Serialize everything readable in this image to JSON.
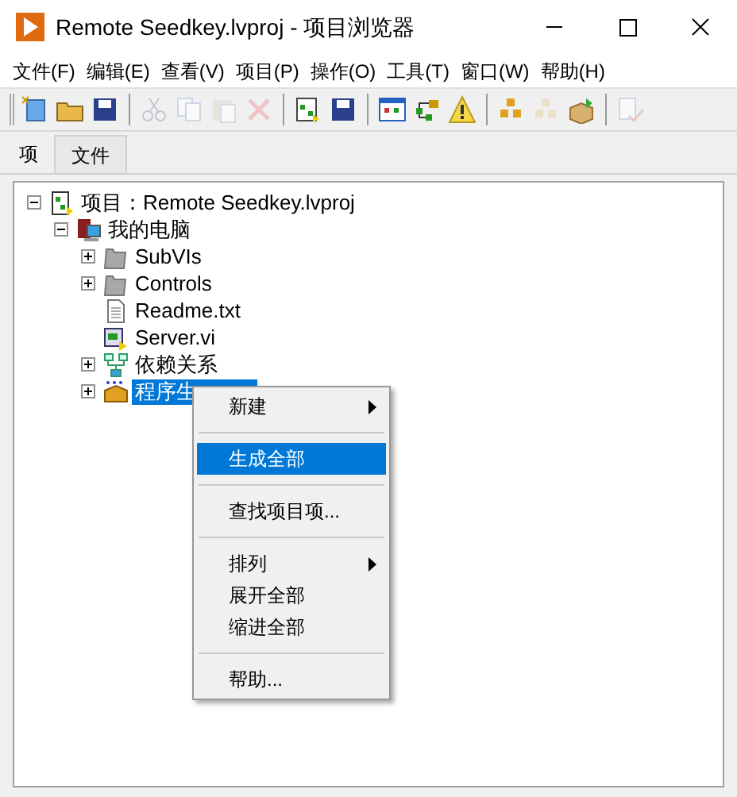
{
  "window": {
    "title": "Remote Seedkey.lvproj - 项目浏览器"
  },
  "menu_bar": [
    "文件(F)",
    "编辑(E)",
    "查看(V)",
    "项目(P)",
    "操作(O)",
    "工具(T)",
    "窗口(W)",
    "帮助(H)"
  ],
  "toolbar": [
    {
      "kind": "new",
      "disabled": false
    },
    {
      "kind": "open",
      "disabled": false
    },
    {
      "kind": "save",
      "disabled": false
    },
    {
      "kind": "sep"
    },
    {
      "kind": "cut",
      "disabled": true
    },
    {
      "kind": "copy",
      "disabled": true
    },
    {
      "kind": "paste",
      "disabled": true
    },
    {
      "kind": "delete",
      "disabled": true
    },
    {
      "kind": "sep"
    },
    {
      "kind": "vi",
      "disabled": false
    },
    {
      "kind": "save",
      "disabled": false
    },
    {
      "kind": "sep"
    },
    {
      "kind": "view",
      "disabled": false
    },
    {
      "kind": "tree",
      "disabled": false
    },
    {
      "kind": "warn",
      "disabled": false
    },
    {
      "kind": "sep"
    },
    {
      "kind": "build",
      "disabled": false
    },
    {
      "kind": "build",
      "disabled": true
    },
    {
      "kind": "deploy",
      "disabled": false
    },
    {
      "kind": "sep"
    },
    {
      "kind": "check",
      "disabled": true
    }
  ],
  "tabs": [
    {
      "label": "项",
      "selected": true
    },
    {
      "label": "文件",
      "selected": false
    }
  ],
  "tree": [
    {
      "label": "项目：Remote Seedkey.lvproj",
      "kind": "project",
      "expanded": true,
      "selected": false,
      "children": [
        {
          "label": "我的电脑",
          "kind": "computer",
          "expanded": true,
          "selected": false,
          "children": [
            {
              "label": "SubVIs",
              "kind": "folder",
              "expanded": false,
              "selected": false
            },
            {
              "label": "Controls",
              "kind": "folder",
              "expanded": false,
              "selected": false
            },
            {
              "label": "Readme.txt",
              "kind": "file",
              "selected": false
            },
            {
              "label": "Server.vi",
              "kind": "vi",
              "selected": false
            },
            {
              "label": "依赖关系",
              "kind": "deps",
              "expanded": false,
              "selected": false
            },
            {
              "label": "程序生",
              "kind": "build",
              "expanded": false,
              "selected": true
            }
          ]
        }
      ]
    }
  ],
  "context_menu": [
    {
      "kind": "item",
      "label": "新建",
      "submenu": true,
      "selected": false
    },
    {
      "kind": "sep"
    },
    {
      "kind": "item",
      "label": "生成全部",
      "submenu": false,
      "selected": true
    },
    {
      "kind": "sep"
    },
    {
      "kind": "item",
      "label": "查找项目项...",
      "submenu": false,
      "selected": false
    },
    {
      "kind": "sep"
    },
    {
      "kind": "item",
      "label": "排列",
      "submenu": true,
      "selected": false
    },
    {
      "kind": "item",
      "label": "展开全部",
      "submenu": false,
      "selected": false
    },
    {
      "kind": "item",
      "label": "缩进全部",
      "submenu": false,
      "selected": false
    },
    {
      "kind": "sep"
    },
    {
      "kind": "item",
      "label": "帮助...",
      "submenu": false,
      "selected": false
    }
  ]
}
